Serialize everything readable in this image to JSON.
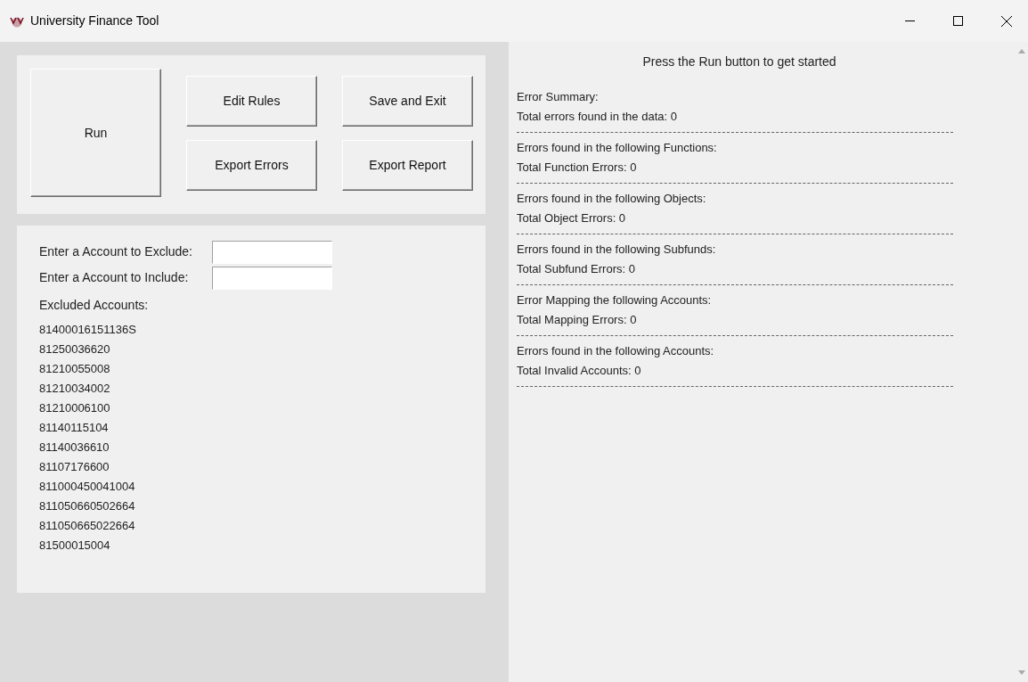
{
  "window": {
    "title": "University Finance Tool"
  },
  "buttons": [
    {
      "label": "Run",
      "kind": "large"
    },
    {
      "label": "Edit Rules",
      "kind": "normal"
    },
    {
      "label": "Save and Exit",
      "kind": "normal"
    },
    {
      "label": "Export Errors",
      "kind": "normal"
    },
    {
      "label": "Export Report",
      "kind": "normal"
    }
  ],
  "fields": [
    {
      "label": "Enter a Account to Exclude:"
    },
    {
      "label": "Enter a Account to Include:"
    }
  ],
  "excluded": {
    "label": "Excluded Accounts:",
    "accounts": [
      "81400016151136S",
      "81250036620",
      "81210055008",
      "81210034002",
      "81210006100",
      "81140115104",
      "81140036610",
      "81107176600",
      "811000450041004",
      "811050660502664",
      "811050665022664",
      "81500015004"
    ]
  },
  "output": {
    "header": "Press the Run button to get started",
    "sections": [
      {
        "title": "Error Summary:",
        "total": "Total errors found in the data: 0"
      },
      {
        "title": "Errors found in the following Functions:",
        "total": "Total Function Errors: 0"
      },
      {
        "title": "Errors found in the following Objects:",
        "total": "Total Object Errors: 0"
      },
      {
        "title": "Errors found in the following Subfunds:",
        "total": "Total Subfund Errors: 0"
      },
      {
        "title": "Error Mapping the following Accounts:",
        "total": "Total Mapping Errors: 0"
      },
      {
        "title": "Errors found in the following Accounts:",
        "total": "Total Invalid Accounts: 0"
      }
    ]
  }
}
